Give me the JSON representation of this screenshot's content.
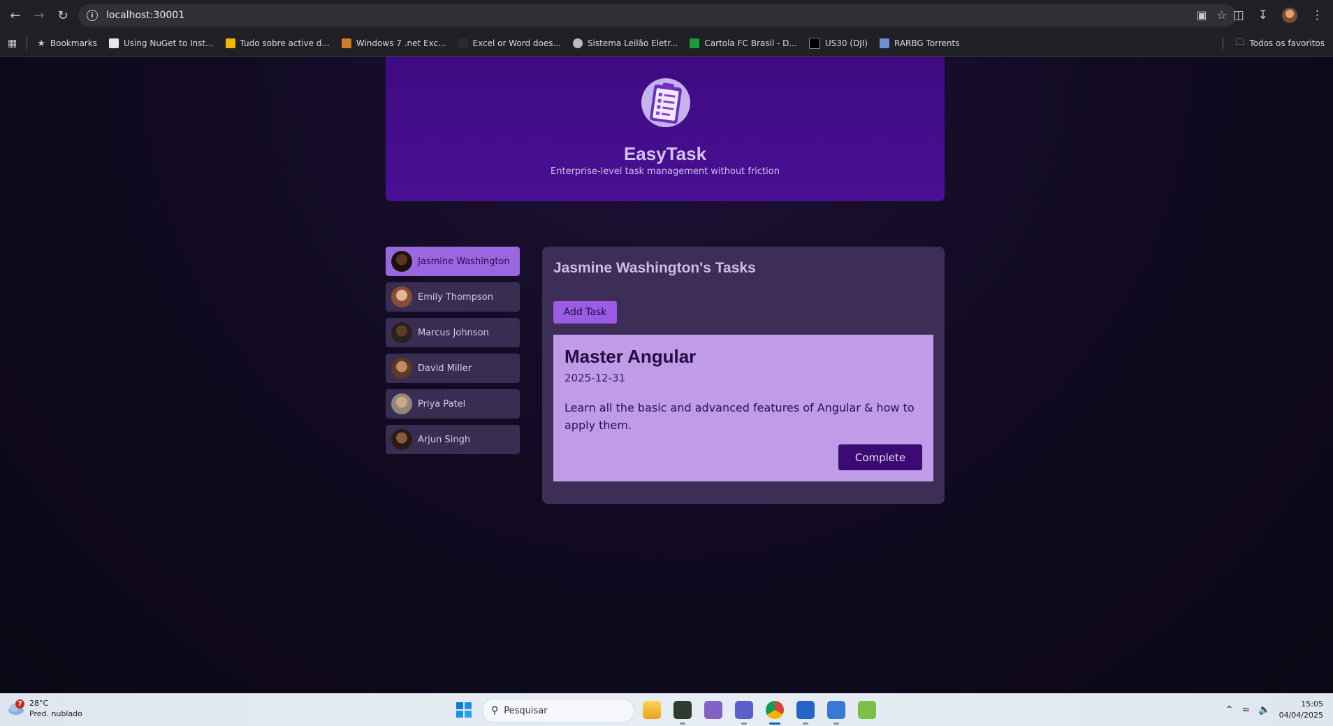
{
  "browser": {
    "url": "localhost:30001",
    "bookmarks": [
      {
        "label": "Bookmarks",
        "icon": "star-icon"
      },
      {
        "label": "Using NuGet to Inst...",
        "color": "#e8e8e8"
      },
      {
        "label": "Tudo sobre active d...",
        "color": "#f5b400"
      },
      {
        "label": "Windows 7 .net Exc...",
        "color": "#d07a2a"
      },
      {
        "label": "Excel or Word does...",
        "color": "#2a2a2a"
      },
      {
        "label": "Sistema Leilão Eletr...",
        "color": "#bcbcbc"
      },
      {
        "label": "Cartola FC Brasil - D...",
        "color": "#1c9a3c"
      },
      {
        "label": "US30 (DJI)",
        "color": "#000000"
      },
      {
        "label": "RARBG Torrents",
        "color": "#6e8fd6"
      }
    ],
    "all_bookmarks_label": "Todos os favoritos"
  },
  "app": {
    "title": "EasyTask",
    "subtitle": "Enterprise-level task management without friction"
  },
  "users": [
    {
      "name": "Jasmine Washington",
      "active": true,
      "avatar_color": "#3a2418"
    },
    {
      "name": "Emily Thompson",
      "active": false,
      "avatar_color": "#b77d63"
    },
    {
      "name": "Marcus Johnson",
      "active": false,
      "avatar_color": "#4a3226"
    },
    {
      "name": "David Miller",
      "active": false,
      "avatar_color": "#8a5a3c"
    },
    {
      "name": "Priya Patel",
      "active": false,
      "avatar_color": "#a9826a"
    },
    {
      "name": "Arjun Singh",
      "active": false,
      "avatar_color": "#5c3a28"
    }
  ],
  "tasks_panel": {
    "title": "Jasmine Washington's Tasks",
    "add_label": "Add Task",
    "tasks": [
      {
        "title": "Master Angular",
        "due_date": "2025-12-31",
        "summary": "Learn all the basic and advanced features of Angular & how to apply them.",
        "complete_label": "Complete"
      }
    ]
  },
  "taskbar": {
    "weather_temp": "28°C",
    "weather_desc": "Pred. nublado",
    "weather_badge": "7",
    "search_label": "Pesquisar",
    "time": "15:05",
    "date": "04/04/2025"
  },
  "colors": {
    "header_bg": "#4a0f94",
    "active_user_bg": "#9b67e0",
    "task_card_bg": "#bf9be8",
    "complete_btn_bg": "#3b0a72"
  }
}
